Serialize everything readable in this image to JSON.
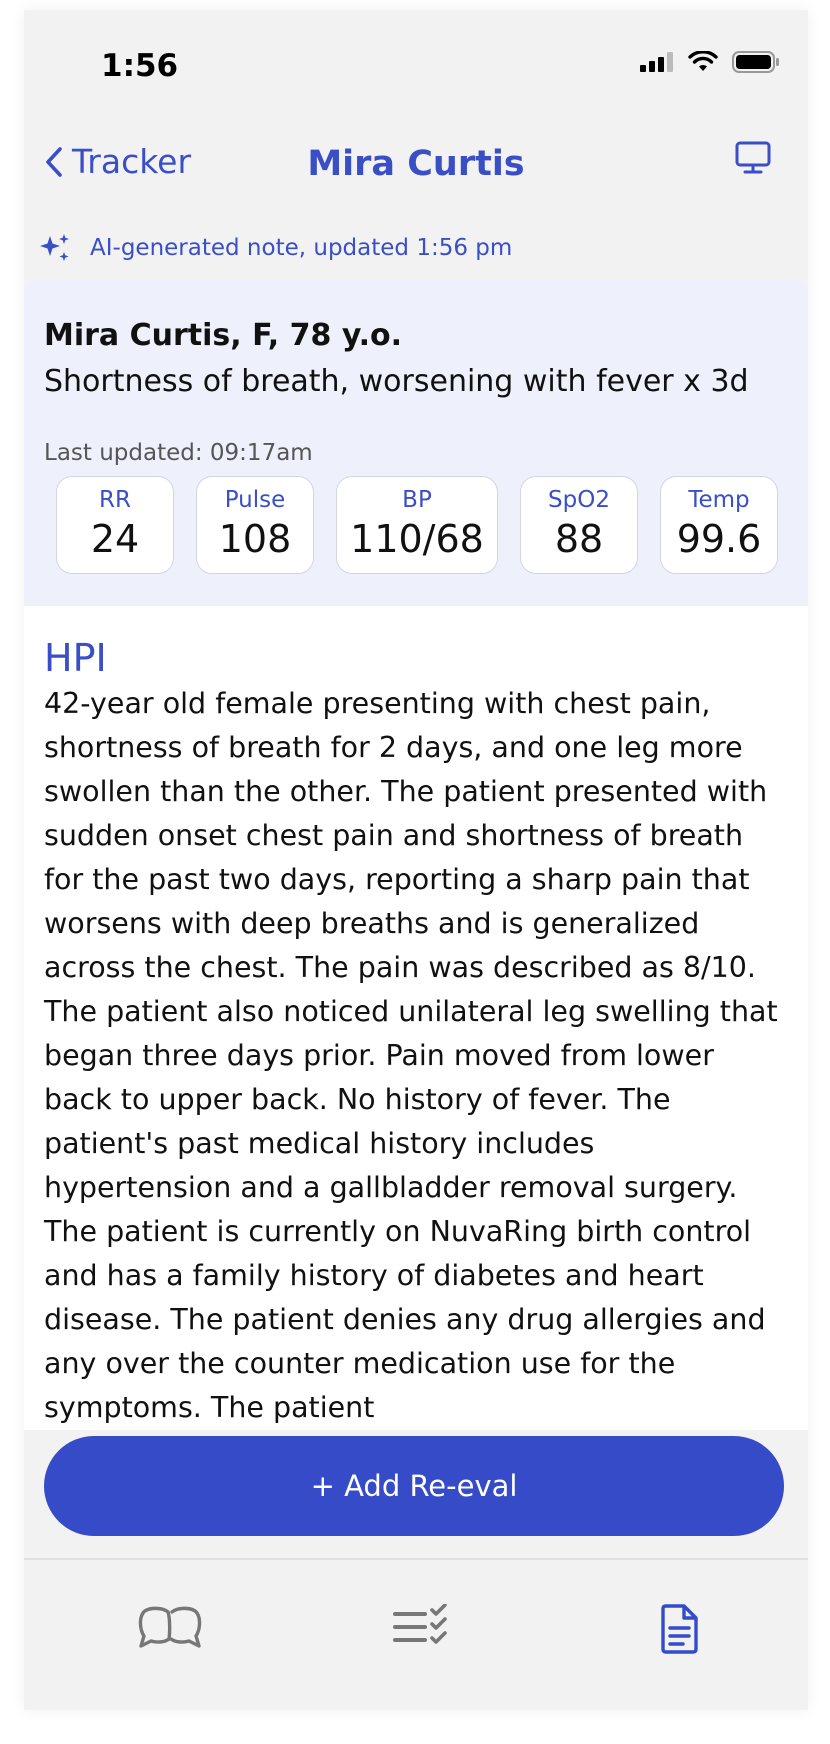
{
  "status_bar": {
    "time": "1:56"
  },
  "nav": {
    "back_label": "Tracker",
    "title": "Mira Curtis"
  },
  "ai_note": {
    "label": "AI-generated note, updated 1:56 pm"
  },
  "summary": {
    "patient": "Mira Curtis, F, 78 y.o.",
    "complaint": "Shortness of breath, worsening with fever x 3d",
    "last_updated": "Last updated: 09:17am",
    "vitals": [
      {
        "label": "RR",
        "value": "24"
      },
      {
        "label": "Pulse",
        "value": "108"
      },
      {
        "label": "BP",
        "value": "110/68"
      },
      {
        "label": "SpO2",
        "value": "88"
      },
      {
        "label": "Temp",
        "value": "99.6"
      }
    ]
  },
  "hpi": {
    "title": "HPI",
    "body": "42-year old female presenting with chest pain, shortness of breath for 2 days, and one leg more swollen than the other. The patient presented with sudden onset chest pain and shortness of breath for the past two days, reporting a sharp pain that worsens with deep breaths and is generalized across the chest. The pain was described as 8/10. The patient also noticed unilateral leg swelling that began three days prior. Pain moved from lower back to upper back. No history of fever. The patient's past medical history includes hypertension and a gallbladder removal surgery. The patient is currently on NuvaRing birth control and has a family history of diabetes and heart disease. The patient denies any drug allergies and any over the counter medication use for the symptoms. The patient"
  },
  "add_button": {
    "label": "+ Add Re-eval"
  },
  "colors": {
    "accent": "#354bc8",
    "accent_text": "#3a4fc6",
    "card_bg": "#eef1fc"
  }
}
